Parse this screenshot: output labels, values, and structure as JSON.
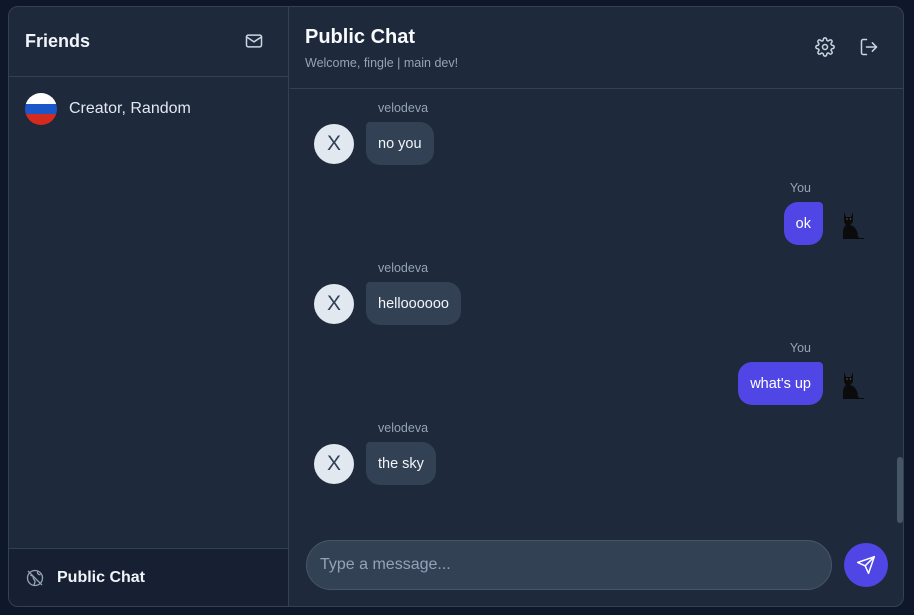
{
  "sidebar": {
    "title": "Friends",
    "mail_icon": "mail-icon",
    "friends": [
      {
        "name": "Creator, Random",
        "flag": "russia-flag",
        "flag_colors": [
          "#ffffff",
          "#1c57c9",
          "#d52b1e"
        ]
      }
    ],
    "footer": {
      "label": "Public Chat",
      "icon": "globe-off-icon"
    }
  },
  "header": {
    "title": "Public Chat",
    "subtitle": "Welcome, fingle | main dev!",
    "settings_icon": "gear-icon",
    "logout_icon": "logout-icon"
  },
  "messages": [
    {
      "sender": "velodeva",
      "text": "no you",
      "self": false,
      "avatar_letter": "X"
    },
    {
      "sender": "You",
      "text": "ok",
      "self": true,
      "avatar": "black-cat-avatar"
    },
    {
      "sender": "velodeva",
      "text": "helloooooo",
      "self": false,
      "avatar_letter": "X"
    },
    {
      "sender": "You",
      "text": "what's up",
      "self": true,
      "avatar": "black-cat-avatar"
    },
    {
      "sender": "velodeva",
      "text": "the sky",
      "self": false,
      "avatar_letter": "X"
    }
  ],
  "composer": {
    "placeholder": "Type a message...",
    "value": "",
    "send_icon": "send-icon"
  },
  "colors": {
    "background": "#1e293b",
    "accent": "#4f46e5",
    "other_bubble": "#334155",
    "border": "#334155"
  }
}
